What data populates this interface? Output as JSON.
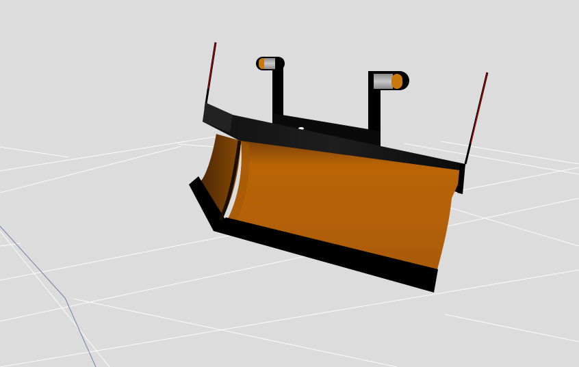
{
  "viewport": {
    "background": "#dcdcdc",
    "grid_line_color": "#ffffff",
    "axis_line_color": "#6e7fa8"
  },
  "model": {
    "object": "snow-plow-blade",
    "blade_color": "#b5620a",
    "frame_color": "#000000",
    "mount_cylinder_color": "#b0b0b0",
    "marker_pole_tip_color": "#d00000"
  }
}
